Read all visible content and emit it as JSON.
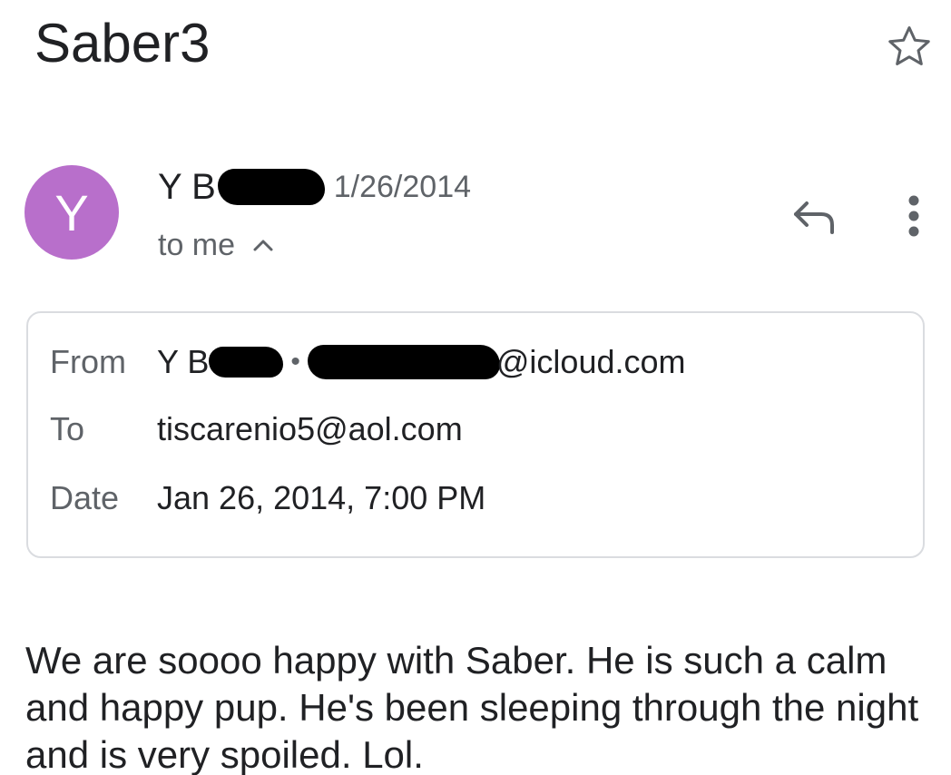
{
  "email": {
    "subject": "Saber3",
    "sender": {
      "avatar_letter": "Y",
      "name_visible": "Y B",
      "date_short": "1/26/2014",
      "recipient_summary": "to me"
    },
    "details": {
      "from_label": "From",
      "from_name_visible": "Y B",
      "from_separator": "•",
      "from_email_visible": "@icloud.com",
      "to_label": "To",
      "to_value": "tiscarenio5@aol.com",
      "date_label": "Date",
      "date_value": "Jan 26, 2014, 7:00 PM"
    },
    "body": "We are soooo happy with Saber. He is such a calm and happy pup. He's been sleeping through the night and is very spoiled. Lol."
  },
  "icons": {
    "star": "star-outline-icon",
    "reply": "reply-icon",
    "more": "more-vert-icon",
    "chevron": "chevron-up-icon"
  },
  "colors": {
    "avatar_bg": "#b86fcb",
    "text_primary": "#202124",
    "text_secondary": "#5f6368",
    "border": "#dadce0"
  }
}
